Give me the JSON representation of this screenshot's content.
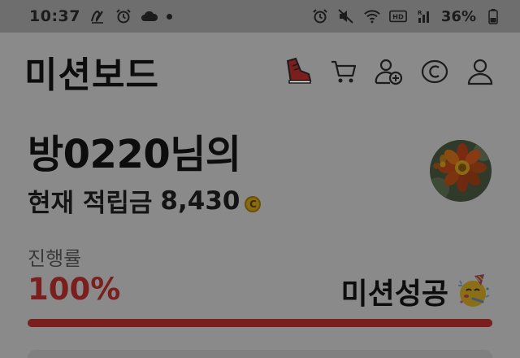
{
  "status_bar": {
    "time": "10:37",
    "battery_percent": "36%",
    "icons_left": [
      "signature-icon",
      "alarm-icon",
      "cloud-icon",
      "notification-dot"
    ],
    "icons_right": [
      "alarm-icon",
      "mute-icon",
      "wifi-icon",
      "hd-icon",
      "signal-icon",
      "battery-icon"
    ]
  },
  "header": {
    "title": "미션보드",
    "icons": [
      "sneaker-icon",
      "cart-icon",
      "add-friend-icon",
      "coin-c-icon",
      "profile-icon"
    ]
  },
  "user": {
    "greeting": "방0220님의",
    "points_label": "현재 적립금",
    "points_value": "8,430",
    "coin_symbol": "C"
  },
  "progress": {
    "label": "진행률",
    "percent_text": "100%",
    "value": 1.0,
    "status": "미션성공"
  },
  "colors": {
    "accent_red": "#7a1e1e",
    "overlay_gray": "#8a8a8a"
  }
}
